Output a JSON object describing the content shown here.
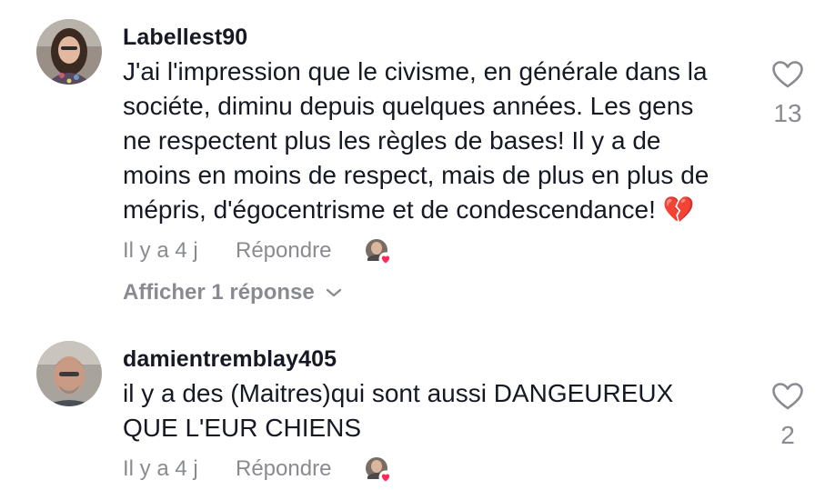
{
  "comments": [
    {
      "username": "Labellest90",
      "text_lines": [
        "J'ai l'impression que le civisme, en générale dans la",
        "sociéte, diminu depuis quelques années. Les gens",
        "ne respectent plus les règles de bases! Il y a de",
        "moins en moins de respect, mais de plus en plus de",
        "mépris, d'égocentrisme et de condescendance! 💔"
      ],
      "time": "Il y a 4 j",
      "reply_label": "Répondre",
      "like_count": "13",
      "view_replies_label": "Afficher 1 réponse",
      "creator_liked_icon": "creator-liked-heart-icon"
    },
    {
      "username": "damientremblay405",
      "text_lines": [
        "il y a des (Maitres)qui sont aussi DANGEUREUX",
        "QUE L'EUR CHIENS"
      ],
      "time": "Il y a 4 j",
      "reply_label": "Répondre",
      "like_count": "2",
      "creator_liked_icon": "creator-liked-heart-icon"
    }
  ],
  "colors": {
    "primary_text": "#161823",
    "secondary_text": "#8a8b91",
    "like_badge": "#fe2c55"
  }
}
